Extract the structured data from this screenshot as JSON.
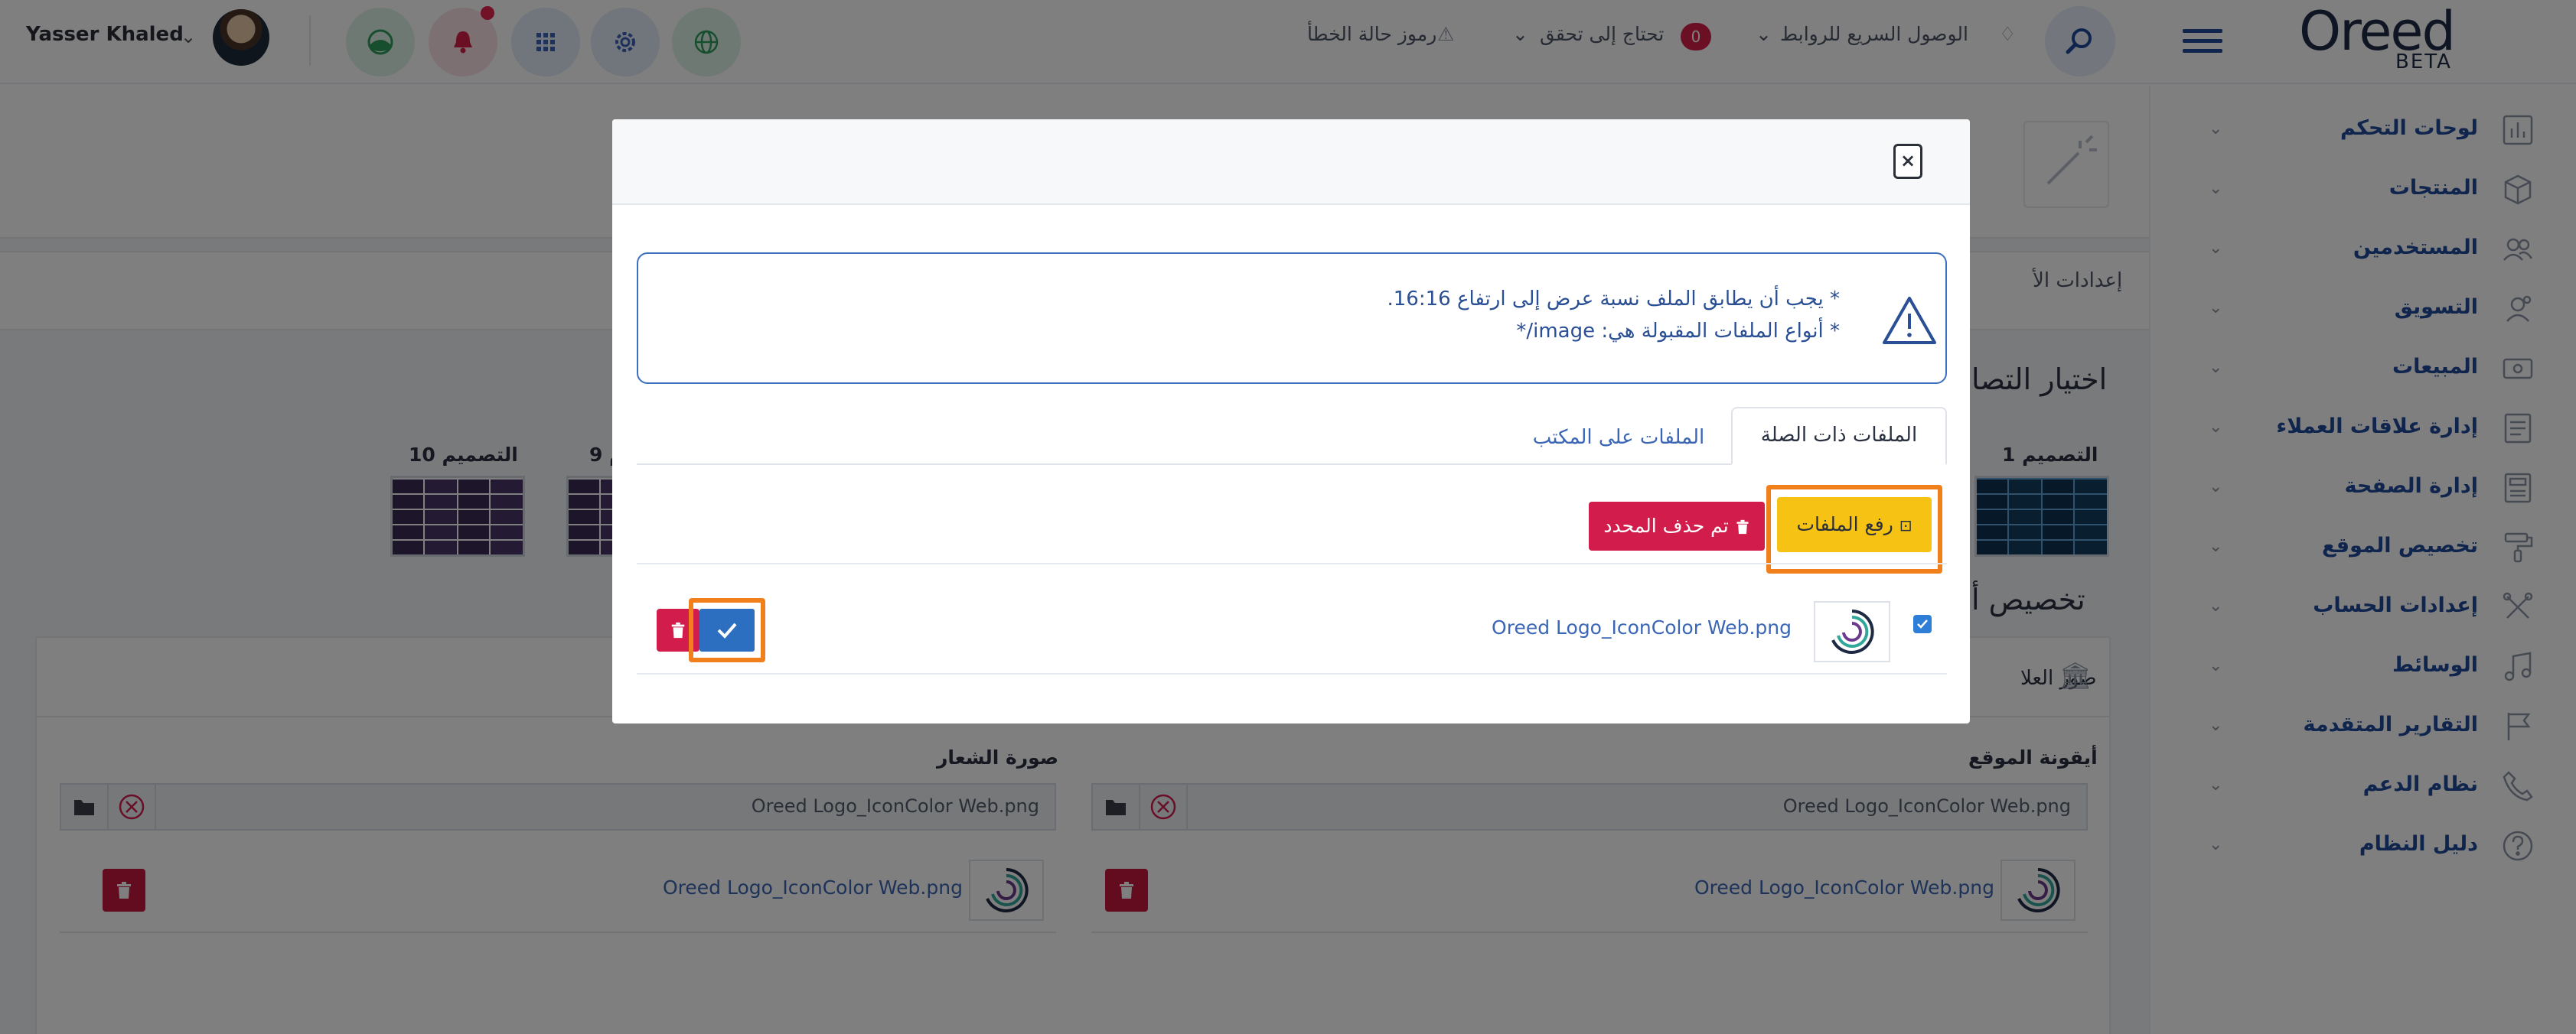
{
  "header": {
    "user_name": "Yasser Khaled",
    "error_codes": "رموز حالة الخطأ",
    "needs_verification": "تحتاج إلى تحقق",
    "needs_verification_count": "0",
    "quick_access": "الوصول السريع للروابط",
    "logo_text": "Oreed",
    "logo_beta": "BETA"
  },
  "sidebar": {
    "items": [
      {
        "label": "لوحات التحكم",
        "icon": "dashboard-icon"
      },
      {
        "label": "المنتجات",
        "icon": "box-icon"
      },
      {
        "label": "المستخدمين",
        "icon": "users-icon"
      },
      {
        "label": "التسويق",
        "icon": "marketing-icon"
      },
      {
        "label": "المبيعات",
        "icon": "sales-icon"
      },
      {
        "label": "إدارة علاقات العملاء",
        "icon": "crm-icon"
      },
      {
        "label": "إدارة الصفحة",
        "icon": "page-icon"
      },
      {
        "label": "تخصيص الموقع",
        "icon": "paint-roller-icon"
      },
      {
        "label": "إعدادات الحساب",
        "icon": "tools-icon"
      },
      {
        "label": "الوسائط",
        "icon": "music-icon"
      },
      {
        "label": "التقارير المتقدمة",
        "icon": "flag-icon"
      },
      {
        "label": "نظام الدعم",
        "icon": "phone-icon"
      },
      {
        "label": "دليل النظام",
        "icon": "help-icon"
      }
    ]
  },
  "background": {
    "settings_tab": "إعدادات الأ",
    "choose_design": "اختيار التصا",
    "design_1": "التصميم 1",
    "design_9": "م 9",
    "design_10": "التصميم 10",
    "customize": "تخصيص أ",
    "brand_images": "صور العلا",
    "site_icon_label": "أيقونة الموقع",
    "logo_image_label": "صورة الشعار",
    "site_icon_value": "Oreed Logo_IconColor Web.png",
    "logo_image_value": "Oreed Logo_IconColor Web.png",
    "site_icon_link": "Oreed Logo_IconColor Web.png",
    "logo_image_link": "Oreed Logo_IconColor Web.png"
  },
  "modal": {
    "close_label": "×",
    "alert_line1": "* يجب أن يطابق الملف نسبة عرض إلى ارتفاع 16:16.",
    "alert_line2": "* أنواع الملفات المقبولة هي: image/*",
    "tab_related": "الملفات ذات الصلة",
    "tab_desktop": "الملفات على المكتب",
    "upload_label": "رفع الملفات",
    "delete_selected_label": "تم حذف المحدد",
    "file_name": "Oreed Logo_IconColor Web.png"
  },
  "colors": {
    "primary": "#1f4a9a",
    "danger": "#d21d4c",
    "warning": "#f6c314",
    "highlight": "#f07f1c"
  }
}
